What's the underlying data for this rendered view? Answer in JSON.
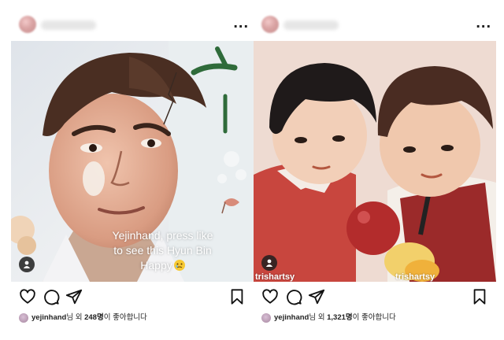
{
  "posts": [
    {
      "more_label": "...",
      "caption_line1": "Yejinhand, press like",
      "caption_line2": "to see this Hyun Bin",
      "caption_line3": "Happy",
      "likes": {
        "user": "yejinhand",
        "middle": "님 외 ",
        "count": "248명",
        "suffix": "이 좋아합니다"
      }
    },
    {
      "more_label": "...",
      "watermark": "trishartsy",
      "likes": {
        "user": "yejinhand",
        "middle": "님 외 ",
        "count": "1,321명",
        "suffix": "이 좋아합니다"
      }
    }
  ],
  "colors": {
    "bg": "#ffffff",
    "text": "#111111",
    "right_bg": "#eedbd2",
    "shirt_red": "#c8463e",
    "vest_red": "#9b2a2a"
  },
  "icons": [
    "heart-icon",
    "comment-icon",
    "share-icon",
    "bookmark-icon",
    "more-icon",
    "profile-tag-icon"
  ]
}
